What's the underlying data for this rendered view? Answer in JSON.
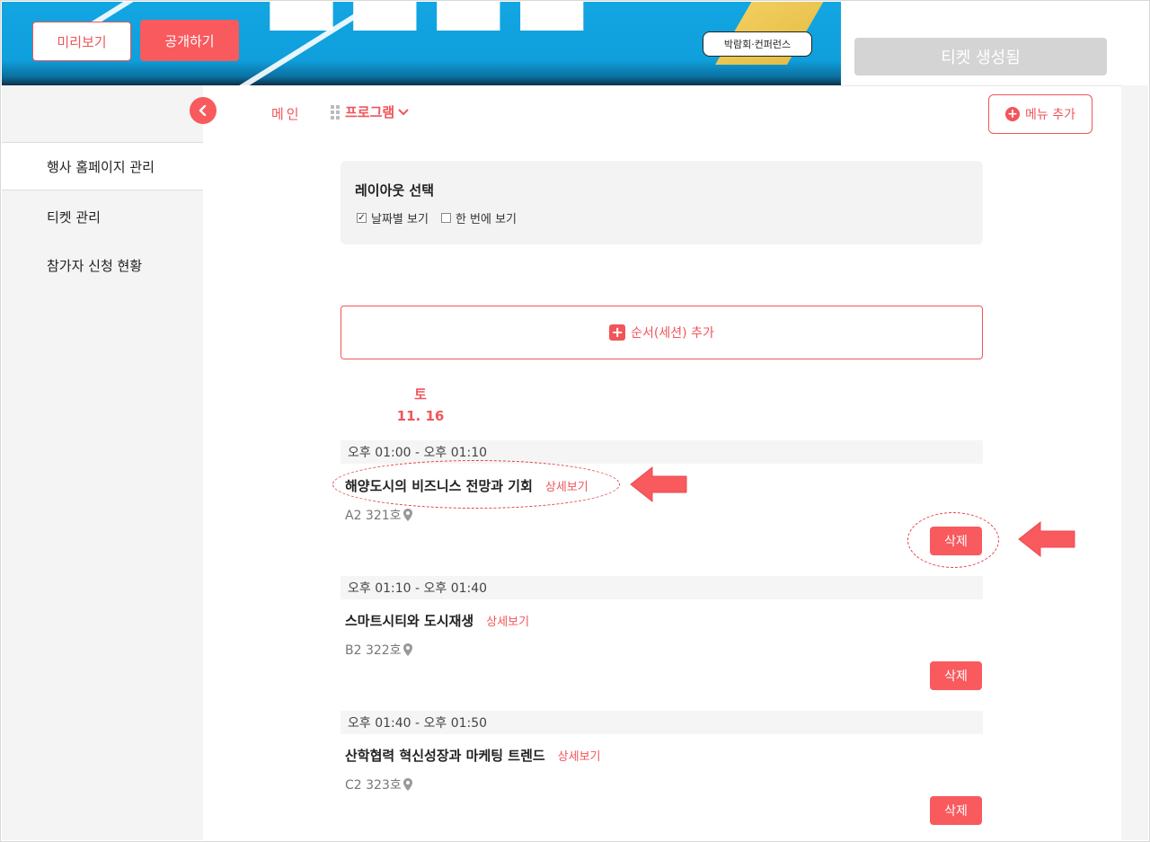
{
  "banner": {
    "preview_label": "미리보기",
    "publish_label": "공개하기",
    "category_badge": "박람회·컨퍼런스"
  },
  "ticket_status_label": "티켓 생성됨",
  "sidebar": {
    "items": [
      {
        "label": "행사 홈페이지 관리",
        "active": true
      },
      {
        "label": "티켓 관리",
        "active": false
      },
      {
        "label": "참가자 신청 현황",
        "active": false
      }
    ]
  },
  "tabs": {
    "main_label": "메인",
    "program_label": "프로그램"
  },
  "add_menu_label": "메뉴 추가",
  "layout": {
    "title": "레이아웃 선택",
    "options": [
      {
        "label": "날짜별 보기",
        "checked": true
      },
      {
        "label": "한 번에 보기",
        "checked": false
      }
    ]
  },
  "add_session_label": "순서(세션) 추가",
  "schedule": {
    "day": "토",
    "date": "11. 16",
    "sessions": [
      {
        "time": "오후 01:00 - 오후 01:10",
        "title": "해양도시의 비즈니스 전망과 기회",
        "detail_label": "상세보기",
        "room": "A2 321호",
        "delete_label": "삭제"
      },
      {
        "time": "오후 01:10 - 오후 01:40",
        "title": "스마트시티와 도시재생",
        "detail_label": "상세보기",
        "room": "B2 322호",
        "delete_label": "삭제"
      },
      {
        "time": "오후 01:40 - 오후 01:50",
        "title": "산학협력 혁신성장과 마케팅 트렌드",
        "detail_label": "상세보기",
        "room": "C2 323호",
        "delete_label": "삭제"
      }
    ]
  },
  "colors": {
    "accent": "#f85a5e",
    "banner_blue": "#12a6e2",
    "disabled_gray": "#d4d4d4"
  }
}
